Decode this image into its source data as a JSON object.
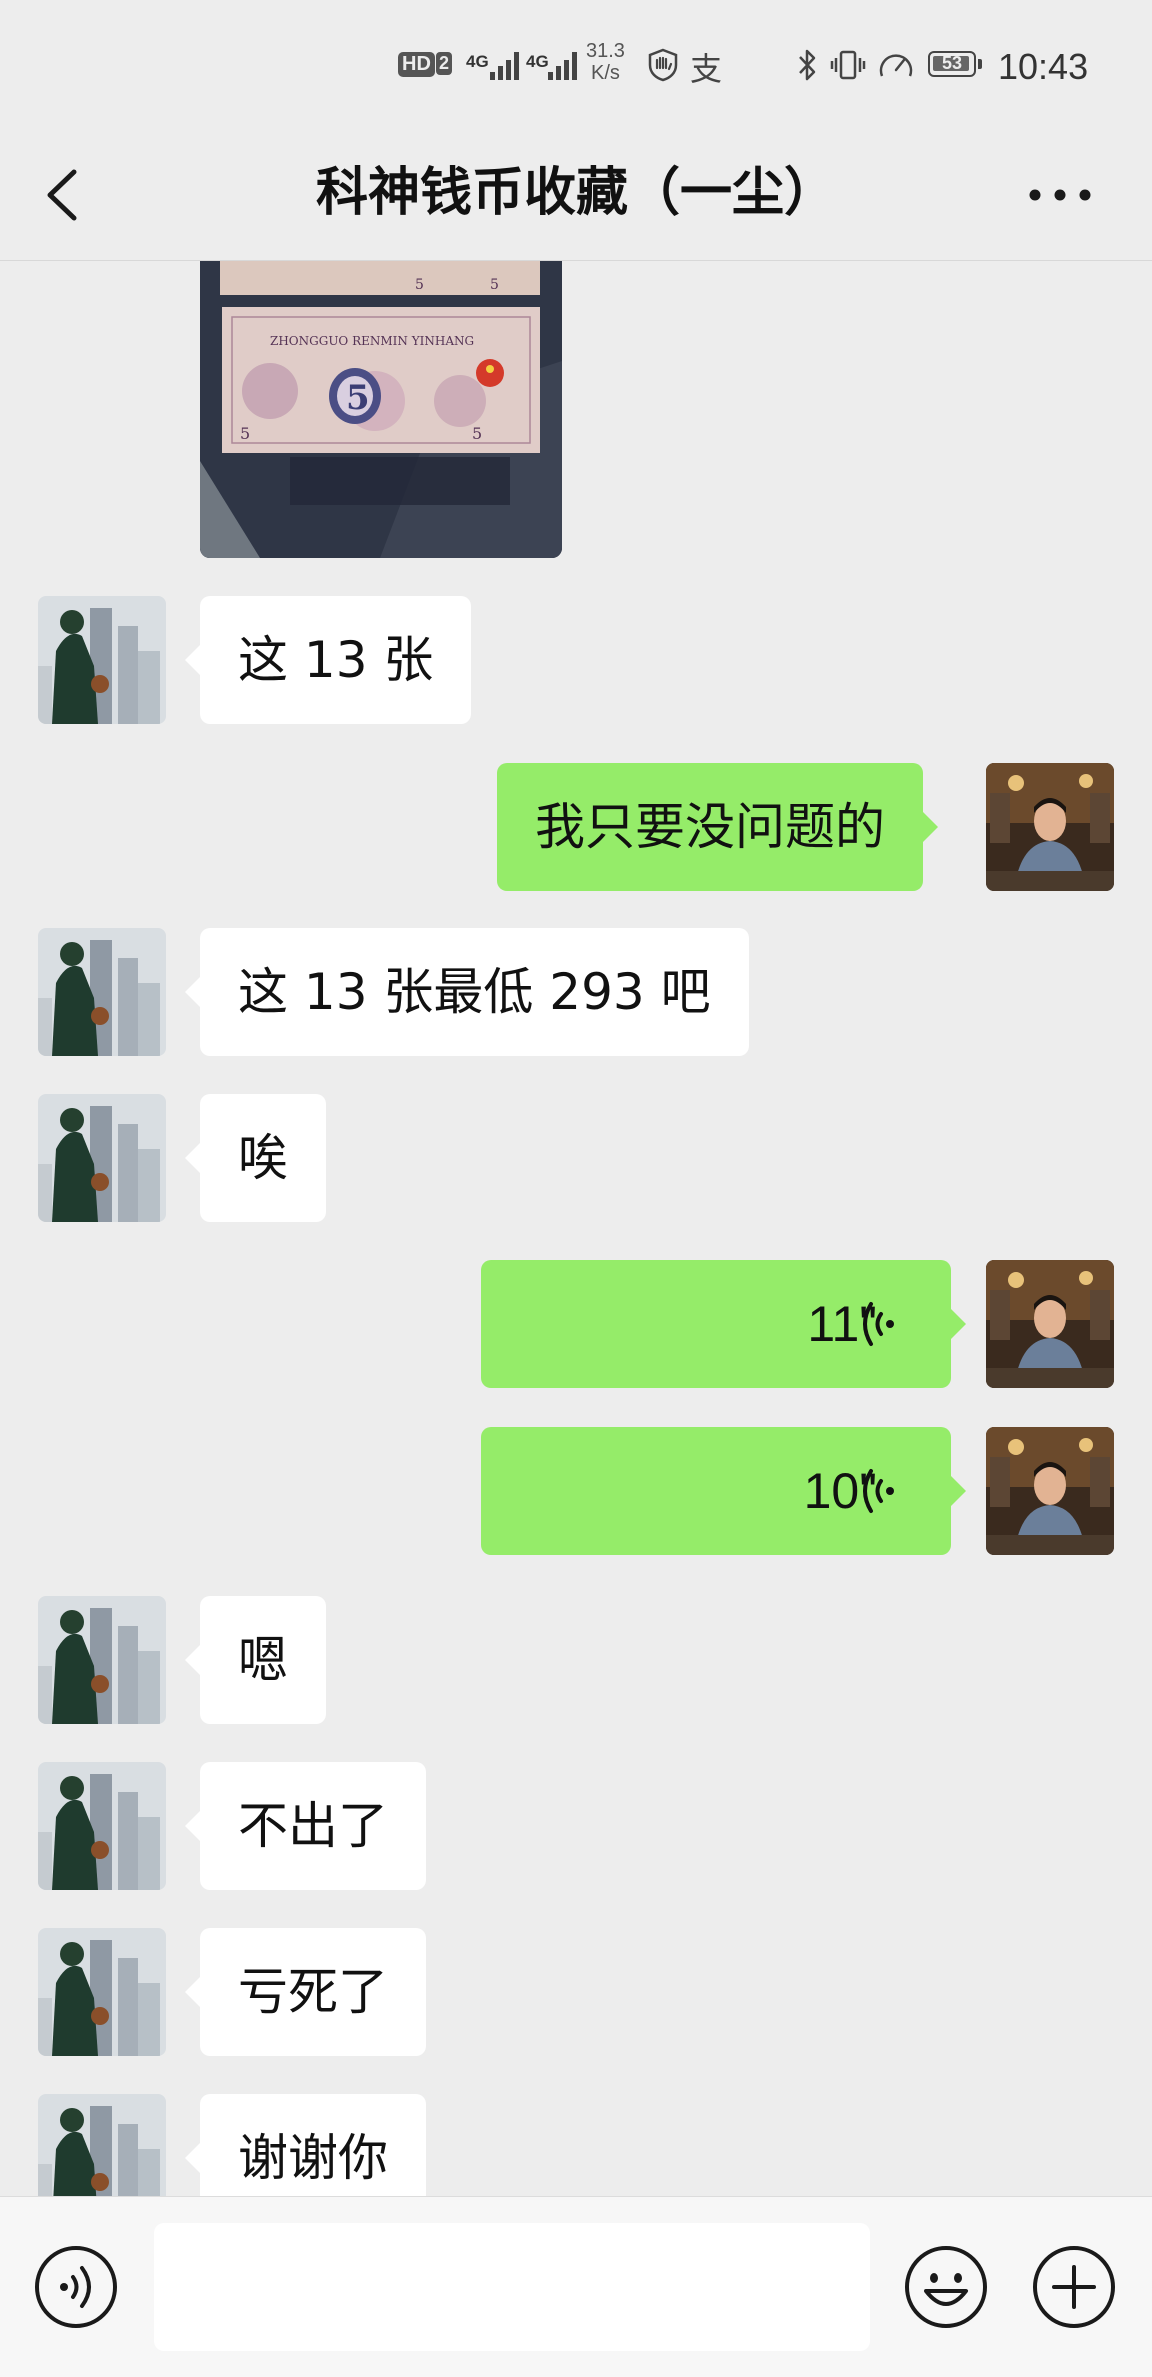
{
  "status_bar": {
    "hd": "HD",
    "sim2": "2",
    "net1": "4G",
    "net2": "4G",
    "speed_value": "31.3",
    "speed_unit": "K/s",
    "alipay": "支",
    "battery": "53",
    "time": "10:43"
  },
  "header": {
    "title": "科神钱币收藏（一尘）"
  },
  "banknote": {
    "text": "ZHONGGUO RENMIN YINHANG",
    "denomination": "5"
  },
  "messages": [
    {
      "side": "left",
      "type": "text",
      "text": "这 13 张"
    },
    {
      "side": "right",
      "type": "text",
      "text": "我只要没问题的"
    },
    {
      "side": "left",
      "type": "text",
      "text": "这 13 张最低 293 吧"
    },
    {
      "side": "left",
      "type": "text",
      "text": "唉"
    },
    {
      "side": "right",
      "type": "voice",
      "text": "11\""
    },
    {
      "side": "right",
      "type": "voice",
      "text": "10\""
    },
    {
      "side": "left",
      "type": "text",
      "text": "嗯"
    },
    {
      "side": "left",
      "type": "text",
      "text": "不出了"
    },
    {
      "side": "left",
      "type": "text",
      "text": "亏死了"
    },
    {
      "side": "left",
      "type": "text",
      "text": "谢谢你"
    }
  ],
  "icons": {
    "back": "chevron-left-icon",
    "more": "more-dots-icon",
    "voice_input": "voice-input-icon",
    "emoji": "emoji-icon",
    "plus": "plus-icon"
  },
  "colors": {
    "background": "#ededed",
    "right_bubble": "#95ec69",
    "left_bubble": "#ffffff"
  }
}
